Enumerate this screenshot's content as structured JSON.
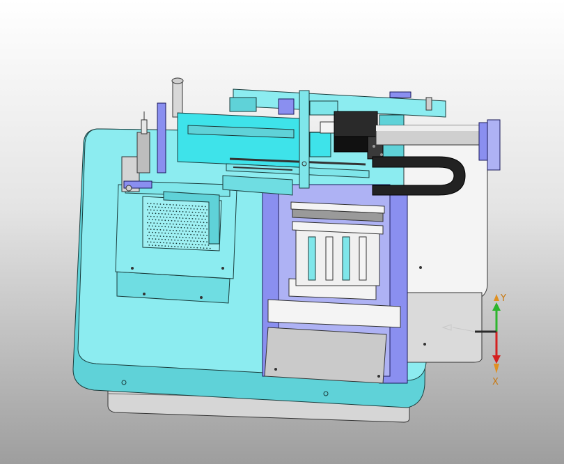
{
  "viewport": {
    "background_top": "#ffffff",
    "background_bottom": "#9e9e9e"
  },
  "colors": {
    "body_cyan": "#7fe6ea",
    "body_cyan_dark": "#4fc9cf",
    "bright_cyan": "#3ee3ea",
    "purple_bracket": "#8a8ff0",
    "white_part": "#f2f2f2",
    "gray_plate": "#c8c8c8",
    "black_block": "#1e1e1e",
    "silver_rod": "#d0d0d0",
    "edge": "#1a3c3c"
  },
  "triad": {
    "y_label": "Y",
    "x_label": "X",
    "y_color": "#2db52d",
    "x_color": "#d42020",
    "z_color": "#2a2ad6",
    "tip_color": "#e09020",
    "label_color": "#c87810"
  }
}
